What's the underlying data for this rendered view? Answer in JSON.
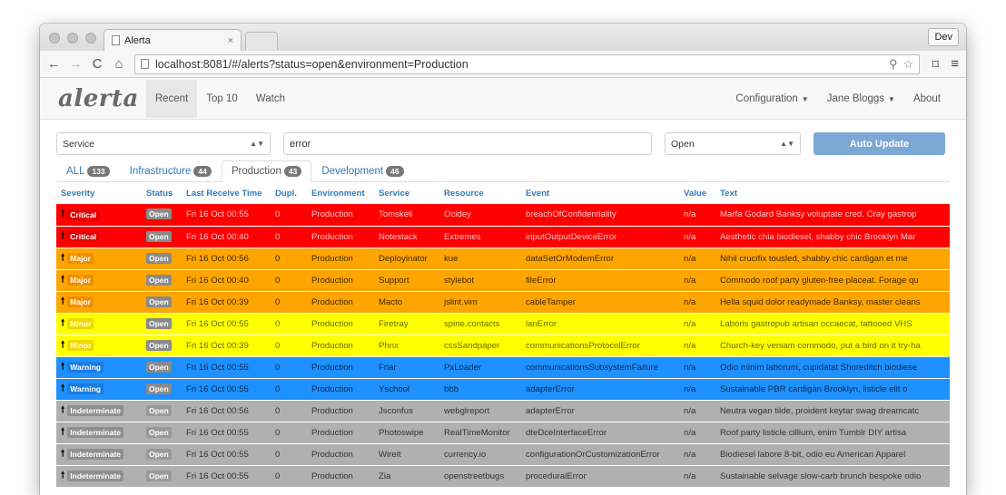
{
  "browser": {
    "tab_title": "Alerta",
    "tab_close": "×",
    "dev_label": "Dev",
    "url": "localhost:8081/#/alerts?status=open&environment=Production"
  },
  "app": {
    "logo": "alerta",
    "nav": {
      "recent": "Recent",
      "top10": "Top 10",
      "watch": "Watch",
      "configuration": "Configuration",
      "user": "Jane Bloggs",
      "about": "About"
    }
  },
  "filters": {
    "service_select": "Service",
    "search_value": "error",
    "status_select": "Open",
    "auto_update": "Auto Update"
  },
  "env_tabs": [
    {
      "label": "ALL",
      "count": "133"
    },
    {
      "label": "Infrastructure",
      "count": "44"
    },
    {
      "label": "Production",
      "count": "43"
    },
    {
      "label": "Development",
      "count": "46"
    }
  ],
  "table": {
    "headers": [
      "Severity",
      "Status",
      "Last Receive Time",
      "Dupl.",
      "Environment",
      "Service",
      "Resource",
      "Event",
      "Value",
      "Text"
    ],
    "rows": [
      {
        "severity": "Critical",
        "status": "Open",
        "time": "Fri 16 Oct 00:55",
        "dupl": "0",
        "env": "Production",
        "service": "Tomskell",
        "resource": "Ocidey",
        "event": "breachOfConfidentiality",
        "value": "n/a",
        "text": "Marfa Godard Banksy voluptate cred. Cray gastrop"
      },
      {
        "severity": "Critical",
        "status": "Open",
        "time": "Fri 16 Oct 00:40",
        "dupl": "0",
        "env": "Production",
        "service": "Notestack",
        "resource": "Extremes",
        "event": "inputOutputDeviceError",
        "value": "n/a",
        "text": "Aesthetic chia biodiesel, shabby chic Brooklyn Mar"
      },
      {
        "severity": "Major",
        "status": "Open",
        "time": "Fri 16 Oct 00:56",
        "dupl": "0",
        "env": "Production",
        "service": "Deployinator",
        "resource": "kue",
        "event": "dataSetOrModemError",
        "value": "n/a",
        "text": "Nihil crucifix tousled, shabby chic cardigan et me"
      },
      {
        "severity": "Major",
        "status": "Open",
        "time": "Fri 16 Oct 00:40",
        "dupl": "0",
        "env": "Production",
        "service": "Support",
        "resource": "stylebot",
        "event": "fileError",
        "value": "n/a",
        "text": "Commodo roof party gluten-free placeat. Forage qu"
      },
      {
        "severity": "Major",
        "status": "Open",
        "time": "Fri 16 Oct 00:39",
        "dupl": "0",
        "env": "Production",
        "service": "Macto",
        "resource": "jslint.vim",
        "event": "cableTamper",
        "value": "n/a",
        "text": "Hella squid dolor readymade Banksy, master cleans"
      },
      {
        "severity": "Minor",
        "status": "Open",
        "time": "Fri 16 Oct 00:55",
        "dupl": "0",
        "env": "Production",
        "service": "Firetray",
        "resource": "spine.contacts",
        "event": "lanError",
        "value": "n/a",
        "text": "Laboris gastropub artisan occaecat, tattooed VHS"
      },
      {
        "severity": "Minor",
        "status": "Open",
        "time": "Fri 16 Oct 00:39",
        "dupl": "0",
        "env": "Production",
        "service": "Phnx",
        "resource": "cssSandpaper",
        "event": "communicationsProtocolError",
        "value": "n/a",
        "text": "Church-key veniam commodo, put a bird on it try-ha"
      },
      {
        "severity": "Warning",
        "status": "Open",
        "time": "Fri 16 Oct 00:55",
        "dupl": "0",
        "env": "Production",
        "service": "Friar",
        "resource": "PxLoader",
        "event": "communicationsSubsystemFailure",
        "value": "n/a",
        "text": "Odio minim laborum, cupidatat Shoreditch biodiese"
      },
      {
        "severity": "Warning",
        "status": "Open",
        "time": "Fri 16 Oct 00:55",
        "dupl": "0",
        "env": "Production",
        "service": "Yschool",
        "resource": "bbb",
        "event": "adapterError",
        "value": "n/a",
        "text": "Sustainable PBR cardigan Brooklyn, listicle elit o"
      },
      {
        "severity": "Indeterminate",
        "status": "Open",
        "time": "Fri 16 Oct 00:56",
        "dupl": "0",
        "env": "Production",
        "service": "Jsconfus",
        "resource": "webglreport",
        "event": "adapterError",
        "value": "n/a",
        "text": "Neutra vegan tilde, proident keytar swag dreamcatc"
      },
      {
        "severity": "Indeterminate",
        "status": "Open",
        "time": "Fri 16 Oct 00:55",
        "dupl": "0",
        "env": "Production",
        "service": "Photoswipe",
        "resource": "RealTimeMonitor",
        "event": "dteDceInterfaceError",
        "value": "n/a",
        "text": "Roof party listicle cillium, enim Tumblr DIY artisa"
      },
      {
        "severity": "Indeterminate",
        "status": "Open",
        "time": "Fri 16 Oct 00:55",
        "dupl": "0",
        "env": "Production",
        "service": "Wireit",
        "resource": "currency.io",
        "event": "configurationOrCustomizationError",
        "value": "n/a",
        "text": "Biodiesel labore 8-bit, odio eu American Apparel"
      },
      {
        "severity": "Indeterminate",
        "status": "Open",
        "time": "Fri 16 Oct 00:55",
        "dupl": "0",
        "env": "Production",
        "service": "Zia",
        "resource": "openstreetbugs",
        "event": "proceduralError",
        "value": "n/a",
        "text": "Sustainable selvage slow-carb brunch bespoke odio"
      }
    ]
  }
}
